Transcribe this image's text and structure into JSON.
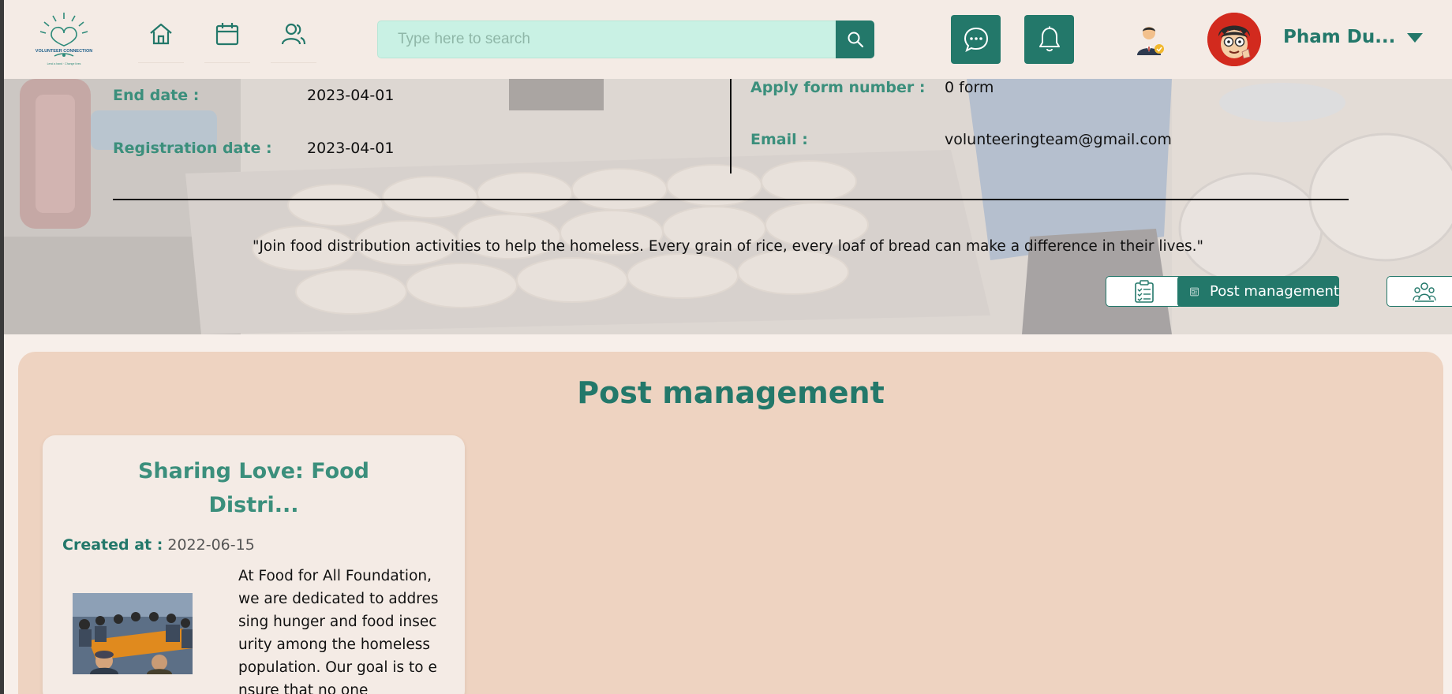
{
  "header": {
    "logo_text": "VOLUNTEER CONNECTION",
    "search_placeholder": "Type here to search",
    "user_name": "Pham Du..."
  },
  "nav": [
    "home-icon",
    "calendar-icon",
    "users-icon"
  ],
  "event_info": {
    "end_date_label": "End date :",
    "end_date_value": "2023-04-01",
    "registration_date_label": "Registration date :",
    "registration_date_value": "2023-04-01",
    "apply_form_label": "Apply form number :",
    "apply_form_value": "0 form",
    "email_label": "Email :",
    "email_value": "volunteeringteam@gmail.com",
    "quote": "\"Join food distribution activities to help the homeless. Every grain of rice, every loaf of bread can make a difference in their lives.\""
  },
  "actions": {
    "post_management_label": "Post management"
  },
  "panel": {
    "title": "Post management"
  },
  "posts": [
    {
      "title": "Sharing Love: Food Distri...",
      "created_label": "Created at :",
      "created_value": "2022-06-15",
      "excerpt": "At Food for All Foundation, we are dedicated to addressing hunger and food insecurity among the homeless population. Our goal is to ensure that no one"
    }
  ],
  "colors": {
    "primary": "#23786a",
    "label_green": "#3b8f7c",
    "panel": "#eed3c1",
    "search_bg": "#c9f1e4"
  }
}
